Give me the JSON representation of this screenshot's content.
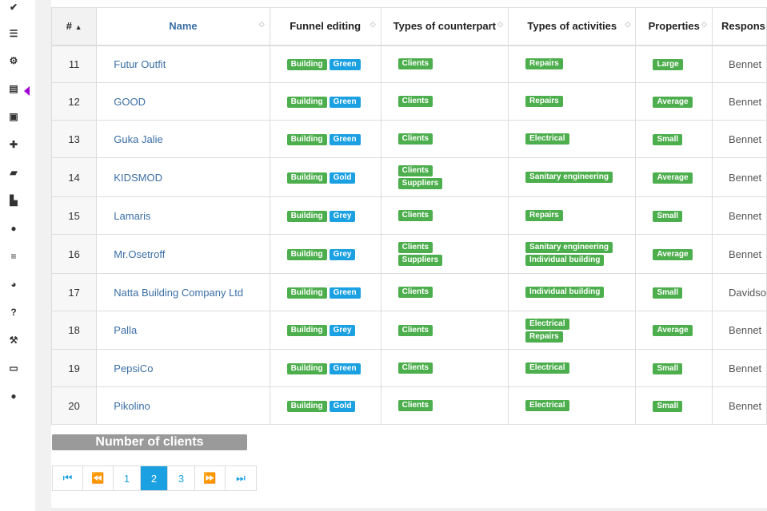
{
  "sidebar": {
    "icons": [
      "check-icon",
      "list-icon",
      "cogs-icon",
      "book-icon",
      "money-icon",
      "puzzle-icon",
      "folder-open-icon",
      "area-chart-icon",
      "users-icon",
      "database-icon",
      "pie-chart-icon",
      "question-icon",
      "wrench-icon",
      "desktop-icon",
      "user-icon"
    ],
    "active_index": 3
  },
  "table": {
    "headers": {
      "num": "#",
      "name": "Name",
      "funnel": "Funnel editing",
      "counterpart": "Types of counterpart",
      "activities": "Types of activities",
      "properties": "Properties",
      "responsible": "Respons"
    },
    "rows": [
      {
        "num": "11",
        "name": "Futur Outfit",
        "funnel": [
          "Building",
          "Green"
        ],
        "counterpart": [
          "Clients"
        ],
        "activities": [
          "Repairs"
        ],
        "properties": "Large",
        "responsible": "Bennet"
      },
      {
        "num": "12",
        "name": "GOOD",
        "funnel": [
          "Building",
          "Green"
        ],
        "counterpart": [
          "Clients"
        ],
        "activities": [
          "Repairs"
        ],
        "properties": "Average",
        "responsible": "Bennet"
      },
      {
        "num": "13",
        "name": "Guka Jalie",
        "funnel": [
          "Building",
          "Green"
        ],
        "counterpart": [
          "Clients"
        ],
        "activities": [
          "Electrical"
        ],
        "properties": "Small",
        "responsible": "Bennet"
      },
      {
        "num": "14",
        "name": "KIDSMOD",
        "funnel": [
          "Building",
          "Gold"
        ],
        "counterpart": [
          "Clients",
          "Suppliers"
        ],
        "activities": [
          "Sanitary engineering"
        ],
        "properties": "Average",
        "responsible": "Bennet"
      },
      {
        "num": "15",
        "name": "Lamaris",
        "funnel": [
          "Building",
          "Grey"
        ],
        "counterpart": [
          "Clients"
        ],
        "activities": [
          "Repairs"
        ],
        "properties": "Small",
        "responsible": "Bennet"
      },
      {
        "num": "16",
        "name": "Mr.Osetroff",
        "funnel": [
          "Building",
          "Grey"
        ],
        "counterpart": [
          "Clients",
          "Suppliers"
        ],
        "activities": [
          "Sanitary engineering",
          "Individual building"
        ],
        "properties": "Average",
        "responsible": "Bennet"
      },
      {
        "num": "17",
        "name": "Natta Building Company Ltd",
        "funnel": [
          "Building",
          "Green"
        ],
        "counterpart": [
          "Clients"
        ],
        "activities": [
          "Individual building"
        ],
        "properties": "Small",
        "responsible": "Davidso"
      },
      {
        "num": "18",
        "name": "Palla",
        "funnel": [
          "Building",
          "Grey"
        ],
        "counterpart": [
          "Clients"
        ],
        "activities": [
          "Electrical",
          "Repairs"
        ],
        "properties": "Average",
        "responsible": "Bennet"
      },
      {
        "num": "19",
        "name": "PepsiCo",
        "funnel": [
          "Building",
          "Green"
        ],
        "counterpart": [
          "Clients"
        ],
        "activities": [
          "Electrical"
        ],
        "properties": "Small",
        "responsible": "Bennet"
      },
      {
        "num": "20",
        "name": "Pikolino",
        "funnel": [
          "Building",
          "Gold"
        ],
        "counterpart": [
          "Clients"
        ],
        "activities": [
          "Electrical"
        ],
        "properties": "Small",
        "responsible": "Bennet"
      }
    ]
  },
  "count_label": "Number of clients",
  "pagination": {
    "first": "first-page-icon",
    "prev": "prev-page-icon",
    "pages": [
      "1",
      "2",
      "3"
    ],
    "current": "2",
    "next": "next-page-icon",
    "last": "last-page-icon"
  },
  "colors": {
    "tag_green": "#4cae4c",
    "tag_blue": "#1ba1e2",
    "link": "#3a6ea5",
    "active_marker": "#a000d0"
  }
}
